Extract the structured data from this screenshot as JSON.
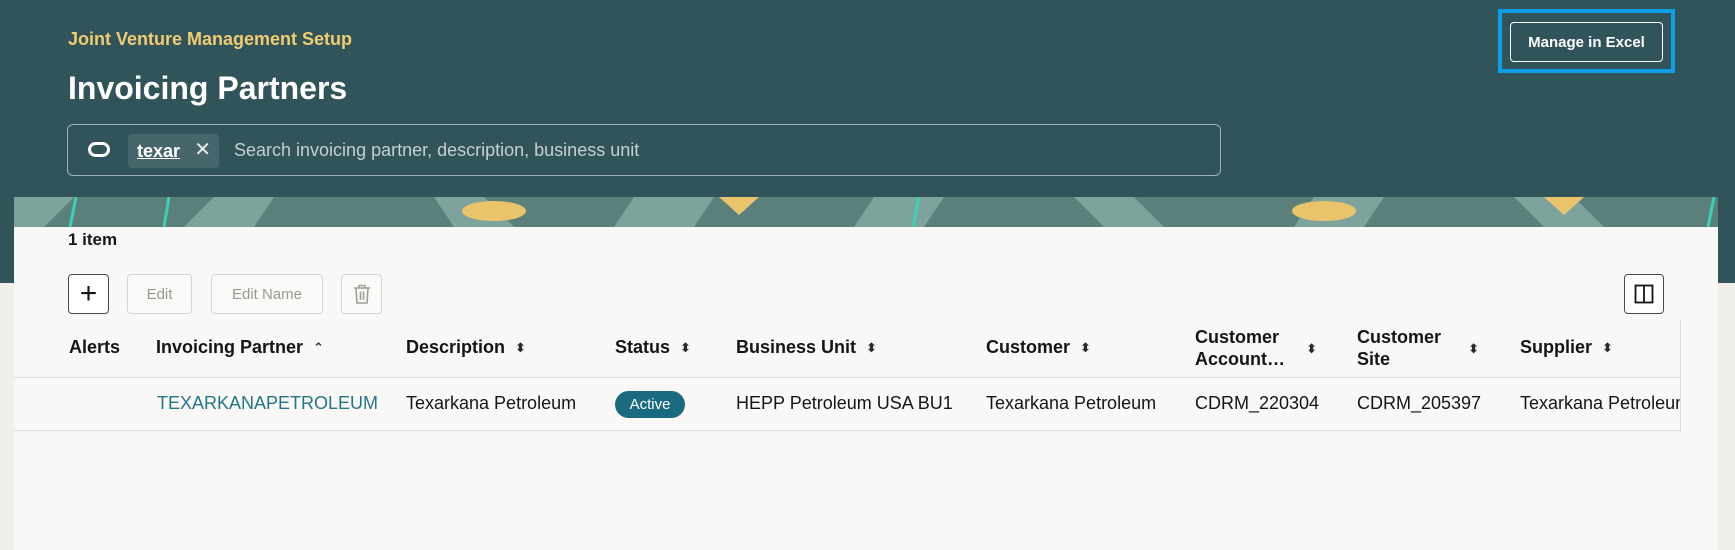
{
  "header": {
    "overline": "Joint Venture Management Setup",
    "title": "Invoicing Partners",
    "manage_excel_label": "Manage in Excel"
  },
  "search": {
    "chip_label": "texar",
    "placeholder": "Search invoicing partner, description, business unit",
    "value": ""
  },
  "results": {
    "count_label": "1 item"
  },
  "toolbar": {
    "add_icon": "plus-icon",
    "edit_label": "Edit",
    "edit_name_label": "Edit Name",
    "delete_icon": "trash-icon",
    "columns_icon": "columns-icon"
  },
  "table": {
    "columns": [
      {
        "label": "Alerts",
        "sortable": false
      },
      {
        "label": "Invoicing Partner",
        "sortable": true,
        "sorted": "ascending"
      },
      {
        "label": "Description",
        "sortable": true
      },
      {
        "label": "Status",
        "sortable": true
      },
      {
        "label": "Business Unit",
        "sortable": true
      },
      {
        "label": "Customer",
        "sortable": true
      },
      {
        "label_line1": "Customer",
        "label_line2": "Account…",
        "sortable": true
      },
      {
        "label_line1": "Customer",
        "label_line2": "Site",
        "sortable": true
      },
      {
        "label": "Supplier",
        "sortable": true
      }
    ],
    "rows": [
      {
        "alerts": "",
        "invoicing_partner": "TEXARKANAPETROLEUM",
        "description": "Texarkana Petroleum",
        "status": "Active",
        "business_unit": "HEPP Petroleum USA BU1",
        "customer": "Texarkana Petroleum",
        "customer_account": "CDRM_220304",
        "customer_site": "CDRM_205397",
        "supplier": "Texarkana Petroleum"
      }
    ]
  },
  "colors": {
    "header_bg": "#31535a",
    "overline": "#f0cc71",
    "focus_ring": "#0d9fe6",
    "status_active": "#1b6b80",
    "link": "#227689"
  }
}
